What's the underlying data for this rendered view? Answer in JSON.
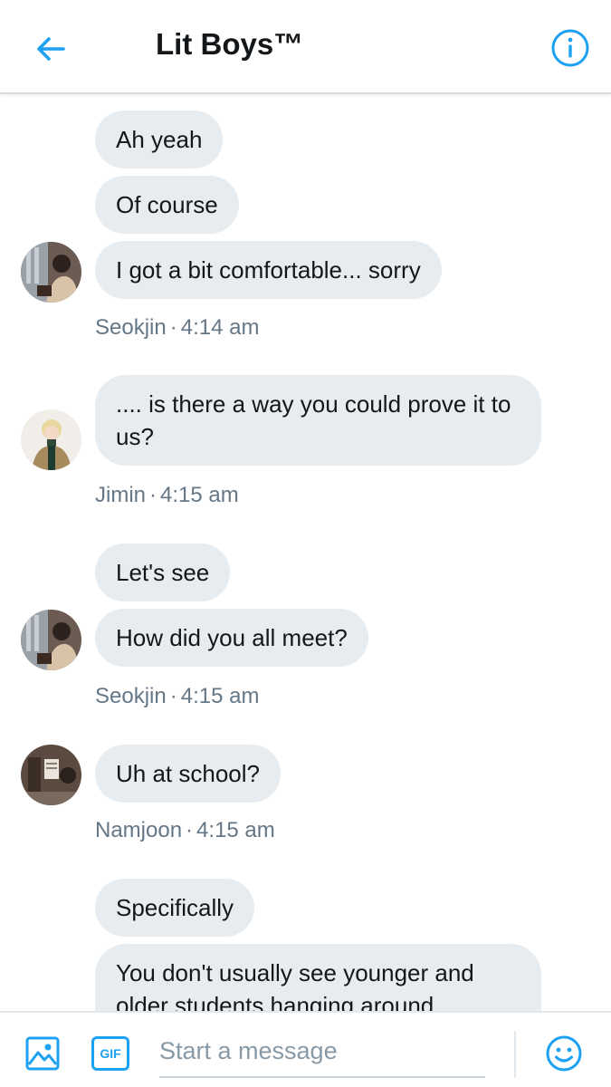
{
  "header": {
    "title": "Lit Boys™",
    "back_icon": "arrow-left-icon",
    "info_icon": "info-icon",
    "accent_color": "#1da1f2"
  },
  "messages": [
    {
      "text": "Ah yeah"
    },
    {
      "text": "Of course"
    },
    {
      "text": "I got a bit comfortable... sorry"
    },
    {
      "author": "Seokjin",
      "time": "4:14 am"
    },
    {
      "text": ".... is there a way you could prove it to us?"
    },
    {
      "author": "Jimin",
      "time": "4:15 am"
    },
    {
      "text": "Let's see"
    },
    {
      "text": "How did you all meet?"
    },
    {
      "author": "Seokjin",
      "time": "4:15 am"
    },
    {
      "text": "Uh at school?"
    },
    {
      "author": "Namjoon",
      "time": "4:15 am"
    },
    {
      "text": "Specifically"
    },
    {
      "text": "You don't usually see younger and older students hanging around"
    }
  ],
  "composer": {
    "placeholder": "Start a message",
    "image_icon": "image-icon",
    "gif_label": "GIF",
    "emoji_icon": "emoji-icon"
  },
  "colors": {
    "bubble_bg": "#e6ecf0",
    "meta_text": "#657786",
    "text": "#14171a"
  }
}
